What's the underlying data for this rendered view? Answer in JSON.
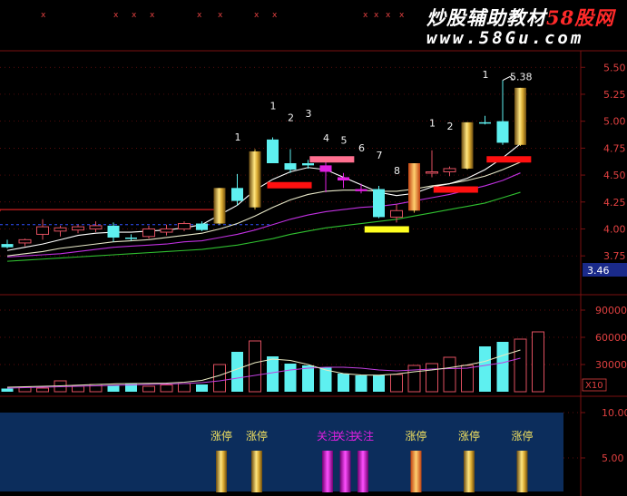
{
  "watermark": {
    "title_main": "炒股辅助教材",
    "title_brand": "58股网",
    "url": "www.58Gu.com"
  },
  "colors": {
    "background": "#000000",
    "grid": "#7a1010",
    "up_candle": "#e05060",
    "down_candle": "#5ef0f0",
    "gold": "#d4b040",
    "bottom_panel": "#0c2d5c",
    "magenta": "#e020e0",
    "red_bar": "#ff1010",
    "pink_bar": "#ff7090",
    "yellow_bar": "#ffff20",
    "axis_text": "#e04040",
    "label_text": "#f0f0f0",
    "signal_text": "#f0e060"
  },
  "top_markers": [
    "x",
    "x",
    "x",
    "x",
    "x",
    "x",
    "x",
    "x",
    "x",
    "x",
    "x",
    "x"
  ],
  "price_axis": {
    "ticks": [
      "5.50",
      "5.25",
      "5.00",
      "4.75",
      "4.50",
      "4.25",
      "4.00",
      "3.75"
    ],
    "current_value": "3.46"
  },
  "volume_axis": {
    "ticks": [
      "90000",
      "60000",
      "30000"
    ],
    "multiplier": "X10"
  },
  "indicator_axis": {
    "ticks": [
      "10.00",
      "5.00"
    ]
  },
  "chart_data": {
    "type": "candlestick",
    "ylim": [
      3.6,
      5.62
    ],
    "price_ticks": [
      5.5,
      5.25,
      5.0,
      4.75,
      4.5,
      4.25,
      4.0,
      3.75
    ],
    "candles": [
      {
        "o": 3.86,
        "h": 3.9,
        "l": 3.82,
        "c": 3.83
      },
      {
        "o": 3.87,
        "h": 3.91,
        "l": 3.84,
        "c": 3.9
      },
      {
        "o": 3.95,
        "h": 4.09,
        "l": 3.9,
        "c": 4.02
      },
      {
        "o": 3.98,
        "h": 4.03,
        "l": 3.93,
        "c": 4.01
      },
      {
        "o": 3.99,
        "h": 4.04,
        "l": 3.96,
        "c": 4.02
      },
      {
        "o": 4.0,
        "h": 4.07,
        "l": 3.97,
        "c": 4.03
      },
      {
        "o": 4.03,
        "h": 4.06,
        "l": 3.88,
        "c": 3.92
      },
      {
        "o": 3.92,
        "h": 3.95,
        "l": 3.89,
        "c": 3.91
      },
      {
        "o": 3.93,
        "h": 4.03,
        "l": 3.91,
        "c": 4.0
      },
      {
        "o": 3.97,
        "h": 4.04,
        "l": 3.94,
        "c": 4.0
      },
      {
        "o": 4.0,
        "h": 4.07,
        "l": 3.98,
        "c": 4.05
      },
      {
        "o": 4.05,
        "h": 4.07,
        "l": 3.98,
        "c": 3.99
      },
      {
        "o": 4.05,
        "h": 4.38,
        "l": 4.04,
        "c": 4.38,
        "gold": true
      },
      {
        "o": 4.38,
        "h": 4.51,
        "l": 4.22,
        "c": 4.26
      },
      {
        "o": 4.2,
        "h": 4.74,
        "l": 4.18,
        "c": 4.72,
        "gold": true
      },
      {
        "o": 4.83,
        "h": 4.85,
        "l": 4.62,
        "c": 4.61
      },
      {
        "o": 4.61,
        "h": 4.74,
        "l": 4.52,
        "c": 4.55
      },
      {
        "o": 4.61,
        "h": 4.64,
        "l": 4.56,
        "c": 4.59
      },
      {
        "o": 4.59,
        "h": 4.62,
        "l": 4.34,
        "c": 4.53,
        "fill": "magenta"
      },
      {
        "o": 4.48,
        "h": 4.52,
        "l": 4.38,
        "c": 4.45,
        "fill": "magenta"
      },
      {
        "o": 4.37,
        "h": 4.42,
        "l": 4.33,
        "c": 4.35,
        "fill": "magenta"
      },
      {
        "o": 4.37,
        "h": 4.4,
        "l": 4.1,
        "c": 4.11
      },
      {
        "o": 4.11,
        "h": 4.23,
        "l": 4.06,
        "c": 4.17
      },
      {
        "o": 4.17,
        "h": 4.61,
        "l": 4.15,
        "c": 4.61,
        "gold": true
      },
      {
        "o": 4.52,
        "h": 4.73,
        "l": 4.48,
        "c": 4.53
      },
      {
        "o": 4.53,
        "h": 4.58,
        "l": 4.49,
        "c": 4.56
      },
      {
        "o": 4.56,
        "h": 4.99,
        "l": 4.55,
        "c": 4.99,
        "gold": true
      },
      {
        "o": 4.99,
        "h": 5.05,
        "l": 4.97,
        "c": 4.98
      },
      {
        "o": 5.0,
        "h": 5.38,
        "l": 4.78,
        "c": 4.8
      },
      {
        "o": 4.78,
        "h": 5.31,
        "l": 4.77,
        "c": 5.31,
        "gold": true
      }
    ],
    "ma_short": [
      3.8,
      3.83,
      3.86,
      3.9,
      3.94,
      3.96,
      3.97,
      3.97,
      3.98,
      3.99,
      4.01,
      4.04,
      4.13,
      4.22,
      4.36,
      4.46,
      4.53,
      4.57,
      4.55,
      4.48,
      4.41,
      4.34,
      4.31,
      4.33,
      4.39,
      4.42,
      4.47,
      4.55,
      4.66,
      4.79
    ],
    "ma_mid": [
      3.75,
      3.77,
      3.79,
      3.82,
      3.84,
      3.86,
      3.88,
      3.89,
      3.9,
      3.92,
      3.94,
      3.96,
      4.0,
      4.05,
      4.12,
      4.2,
      4.27,
      4.32,
      4.35,
      4.36,
      4.36,
      4.35,
      4.35,
      4.37,
      4.4,
      4.42,
      4.45,
      4.49,
      4.55,
      4.62
    ],
    "ma_magenta": [
      3.74,
      3.75,
      3.76,
      3.77,
      3.79,
      3.81,
      3.83,
      3.84,
      3.85,
      3.86,
      3.88,
      3.89,
      3.92,
      3.95,
      3.99,
      4.04,
      4.09,
      4.13,
      4.16,
      4.18,
      4.2,
      4.21,
      4.23,
      4.26,
      4.29,
      4.32,
      4.36,
      4.4,
      4.45,
      4.52
    ],
    "ma_green": [
      3.7,
      3.71,
      3.72,
      3.73,
      3.74,
      3.75,
      3.76,
      3.77,
      3.78,
      3.79,
      3.8,
      3.81,
      3.83,
      3.85,
      3.88,
      3.91,
      3.95,
      3.98,
      4.01,
      4.03,
      4.05,
      4.07,
      4.09,
      4.12,
      4.15,
      4.18,
      4.21,
      4.24,
      4.29,
      4.34
    ],
    "resistance_level": 4.18,
    "dashed_level": 4.04,
    "price_labels": [
      {
        "i": 13,
        "text": "1",
        "y": 4.82
      },
      {
        "i": 15,
        "text": "1",
        "y": 5.11
      },
      {
        "i": 16,
        "text": "2",
        "y": 5.0
      },
      {
        "i": 17,
        "text": "3",
        "y": 5.04
      },
      {
        "i": 18,
        "text": "4",
        "y": 4.81
      },
      {
        "i": 19,
        "text": "5",
        "y": 4.79
      },
      {
        "i": 20,
        "text": "6",
        "y": 4.72
      },
      {
        "i": 21,
        "text": "7",
        "y": 4.65
      },
      {
        "i": 22,
        "text": "8",
        "y": 4.51
      },
      {
        "i": 24,
        "text": "1",
        "y": 4.95
      },
      {
        "i": 25,
        "text": "2",
        "y": 4.92
      },
      {
        "i": 27,
        "text": "1",
        "y": 5.4
      },
      {
        "i": 28,
        "text": "5.38",
        "y": 5.38
      }
    ],
    "markers": [
      {
        "from": 15,
        "to": 16.9,
        "y": 4.41,
        "color": "red_bar"
      },
      {
        "from": 17.4,
        "to": 19.3,
        "y": 4.65,
        "color": "pink_bar"
      },
      {
        "from": 20.5,
        "to": 22.4,
        "y": 4.0,
        "color": "yellow_bar"
      },
      {
        "from": 24.4,
        "to": 26.3,
        "y": 4.37,
        "color": "red_bar"
      },
      {
        "from": 27.4,
        "to": 29.3,
        "y": 4.65,
        "color": "red_bar"
      }
    ],
    "volume": {
      "ylim": [
        0,
        100000
      ],
      "values": [
        3500,
        5000,
        4000,
        12000,
        6000,
        8000,
        7000,
        9000,
        6000,
        7500,
        9000,
        8000,
        30000,
        44000,
        56000,
        39000,
        31000,
        29000,
        27000,
        20000,
        18000,
        18000,
        19000,
        29000,
        31000,
        38000,
        29000,
        50000,
        55000,
        58000,
        66000
      ],
      "ma1": [
        5000,
        5500,
        6000,
        6500,
        7200,
        8000,
        8600,
        9000,
        9200,
        9500,
        10500,
        12500,
        18000,
        25000,
        32000,
        36000,
        34500,
        30000,
        24000,
        20000,
        18500,
        18200,
        19500,
        22000,
        24000,
        26500,
        29500,
        33500,
        40000,
        46000,
        52000
      ],
      "ma2": [
        4000,
        4500,
        5000,
        5500,
        6000,
        6500,
        7000,
        7500,
        8000,
        8500,
        9000,
        10000,
        12000,
        15000,
        18000,
        21000,
        24000,
        26000,
        27000,
        27000,
        26000,
        24000,
        23000,
        24000,
        25000,
        25500,
        26000,
        29000,
        32000,
        37000,
        43000
      ]
    },
    "signals": [
      {
        "i": 12,
        "text": "涨停",
        "color": "gold"
      },
      {
        "i": 14,
        "text": "涨停",
        "color": "gold"
      },
      {
        "i": 18,
        "text": "关注",
        "color": "magenta"
      },
      {
        "i": 19,
        "text": "关注",
        "color": "magenta"
      },
      {
        "i": 20,
        "text": "关注",
        "color": "magenta"
      },
      {
        "i": 23,
        "text": "涨停",
        "color": "gold"
      },
      {
        "i": 26,
        "text": "涨停",
        "color": "gold"
      },
      {
        "i": 29,
        "text": "涨停",
        "color": "gold"
      }
    ]
  }
}
